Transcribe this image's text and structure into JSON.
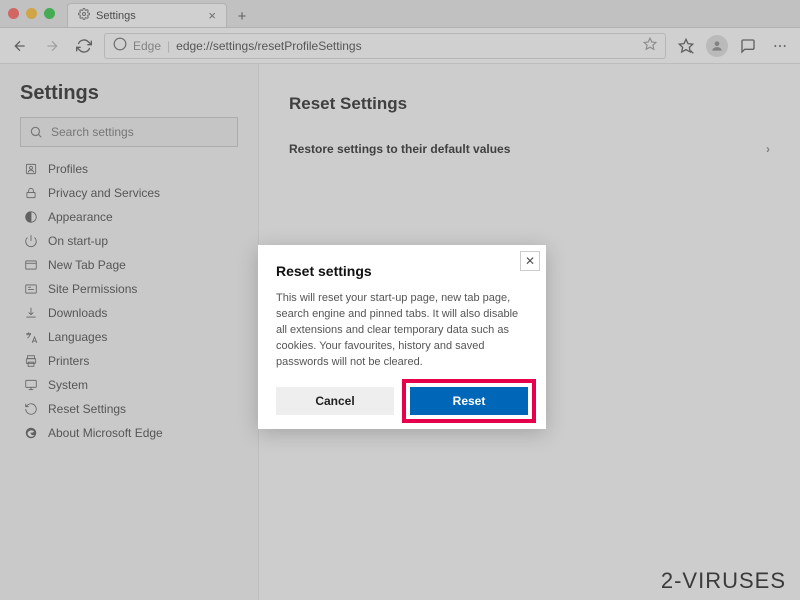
{
  "window": {
    "tab_title": "Settings",
    "tab_close": "×",
    "new_tab": "+"
  },
  "addressbar": {
    "prefix": "Edge",
    "url": "edge://settings/resetProfileSettings"
  },
  "sidebar": {
    "title": "Settings",
    "search_placeholder": "Search settings",
    "items": [
      {
        "label": "Profiles"
      },
      {
        "label": "Privacy and Services"
      },
      {
        "label": "Appearance"
      },
      {
        "label": "On start-up"
      },
      {
        "label": "New Tab Page"
      },
      {
        "label": "Site Permissions"
      },
      {
        "label": "Downloads"
      },
      {
        "label": "Languages"
      },
      {
        "label": "Printers"
      },
      {
        "label": "System"
      },
      {
        "label": "Reset Settings"
      },
      {
        "label": "About Microsoft Edge"
      }
    ]
  },
  "main": {
    "title": "Reset Settings",
    "row_label": "Restore settings to their default values",
    "chevron": "›"
  },
  "dialog": {
    "title": "Reset settings",
    "text": "This will reset your start-up page, new tab page, search engine and pinned tabs. It will also disable all extensions and clear temporary data such as cookies. Your favourites, history and saved passwords will not be cleared.",
    "cancel": "Cancel",
    "reset": "Reset",
    "close": "✕"
  },
  "watermark": "2-VIRUSES"
}
